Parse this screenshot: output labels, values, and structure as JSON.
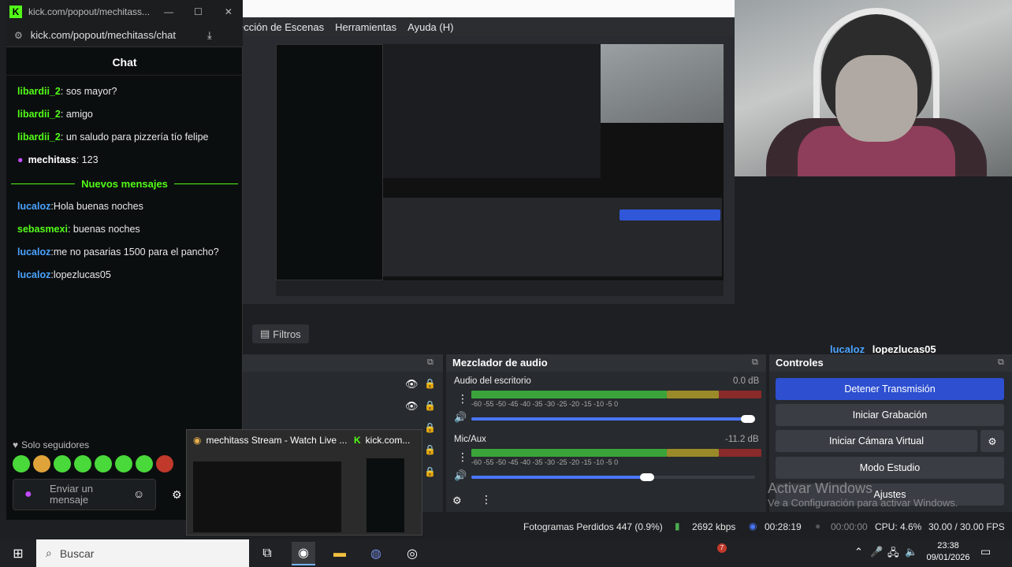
{
  "obs": {
    "menu": [
      "ección de Escenas",
      "Herramientas",
      "Ayuda (H)"
    ],
    "filters_label": "Filtros",
    "overlay_user": "lucaloz",
    "overlay_msg": "lopezlucas05",
    "mixer": {
      "title": "Mezclador de audio",
      "ch1_name": "Audio del escritorio",
      "ch1_db": "0.0 dB",
      "ch2_name": "Mic/Aux",
      "ch2_db": "-11.2 dB",
      "ticks": "-60  -55  -50  -45  -40  -35  -30  -25  -20  -15  -10  -5  0",
      "ch1_volume": 1.0,
      "ch2_volume": 0.62
    },
    "controls": {
      "title": "Controles",
      "stop_stream": "Detener Transmisión",
      "start_rec": "Iniciar Grabación",
      "virtual_cam": "Iniciar Cámara Virtual",
      "studio": "Modo Estudio",
      "settings": "Ajustes"
    },
    "status": {
      "dropped": "Fotogramas Perdidos 447 (0.9%)",
      "kbps": "2692 kbps",
      "stream_time": "00:28:19",
      "rec_time": "00:00:00",
      "cpu": "CPU: 4.6%",
      "fps": "30.00 / 30.00 FPS"
    },
    "watermark_title": "Activar Windows",
    "watermark_sub": "Ve a Configuración para activar Windows."
  },
  "chat": {
    "window_title": "kick.com/popout/mechitass...",
    "url": "kick.com/popout/mechitass/chat",
    "header": "Chat",
    "messages": [
      {
        "user": "libardii_2",
        "sep": ": ",
        "text": "sos mayor?"
      },
      {
        "user": "libardii_2",
        "sep": ": ",
        "text": "amigo"
      },
      {
        "user": "libardii_2",
        "sep": ": ",
        "text": "un saludo para pizzería tío felipe"
      },
      {
        "user": "mechitass",
        "sep": ": ",
        "text": "123"
      },
      {
        "user": "lucaloz",
        "sep": ":",
        "text": "Hola buenas noches"
      },
      {
        "user": "sebasmexi",
        "sep": ": ",
        "text": "buenas noches"
      },
      {
        "user": "lucaloz",
        "sep": ":",
        "text": "me no pasarias 1500 para el pancho?"
      },
      {
        "user": "lucaloz",
        "sep": ":",
        "text": "lopezlucas05"
      }
    ],
    "new_messages": "Nuevos mensajes",
    "followers_only": "Solo seguidores",
    "input_placeholder": "Enviar un mensaje"
  },
  "taskbar_preview": {
    "tab1": "mechitass Stream - Watch Live ...",
    "tab2": "kick.com..."
  },
  "taskbar": {
    "search": "Buscar",
    "time": "23:38",
    "date": "09/01/2026",
    "badge": "7"
  }
}
